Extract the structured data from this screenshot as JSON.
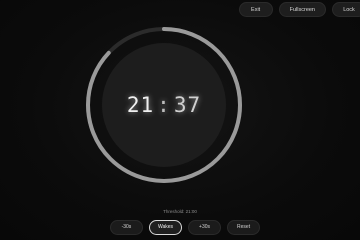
{
  "top_controls": {
    "exit_label": "Exit",
    "fullscreen_label": "Fullscreen",
    "lock_label": "Lock"
  },
  "timer": {
    "minutes": "21",
    "separator": ":",
    "seconds": "37",
    "progress": 0.87
  },
  "threshold_text": "Threshold: 21:00",
  "bottom_controls": {
    "minus_label": "-30s",
    "pause_label": "Wakes",
    "plus_label": "+30s",
    "reset_label": "Reset"
  },
  "colors": {
    "background": "#0b0b0b",
    "ring_track": "#2b2b2b",
    "ring_progress": "#9a9a9a",
    "inner_circle": "#1d1d1d"
  }
}
